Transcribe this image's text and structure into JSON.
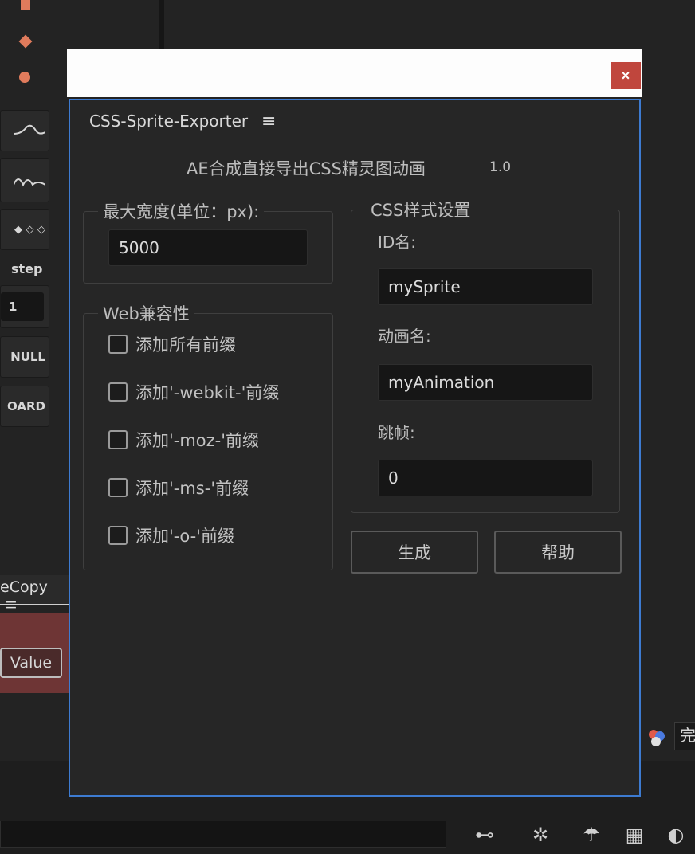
{
  "background_panel": {
    "tool_labels": [
      "step",
      "1",
      "NULL",
      "OARD"
    ],
    "copy_tab_label": "eCopy",
    "copy_tab_menu": "≡",
    "value_button_label": "Value",
    "right_tag_label": "完"
  },
  "window": {
    "close_label": "×",
    "panel_title": "CSS-Sprite-Exporter",
    "menu_glyph": "≡",
    "subtitle": "AE合成直接导出CSS精灵图动画",
    "version": "1.0"
  },
  "width_group": {
    "legend": "最大宽度(单位：px):",
    "value": "5000"
  },
  "web_group": {
    "legend": "Web兼容性",
    "options": [
      {
        "label": "添加所有前缀",
        "checked": false
      },
      {
        "label": "添加'-webkit-'前缀",
        "checked": false
      },
      {
        "label": "添加'-moz-'前缀",
        "checked": false
      },
      {
        "label": "添加'-ms-'前缀",
        "checked": false
      },
      {
        "label": "添加'-o-'前缀",
        "checked": false
      }
    ]
  },
  "css_group": {
    "legend": "CSS样式设置",
    "id_label": "ID名:",
    "id_value": "mySprite",
    "anim_label": "动画名:",
    "anim_value": "myAnimation",
    "skip_label": "跳帧:",
    "skip_value": "0"
  },
  "buttons": {
    "generate": "生成",
    "help": "帮助"
  },
  "colors": {
    "accent_border": "#3d7bd1",
    "close_bg": "#c0463d",
    "shape_color": "#e07b5c"
  }
}
